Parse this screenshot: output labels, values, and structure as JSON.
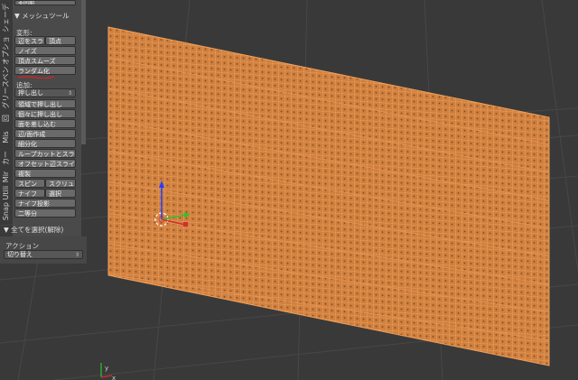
{
  "toolshelf": {
    "top_partial_label": "非同期",
    "tabs": [
      "シェーデ",
      "オプショ",
      "グリースペン",
      "回",
      "Mis",
      "カー",
      "Mir",
      "Snap Utili"
    ],
    "mesh_tools_header": "▼ メッシュツール",
    "deform_label": "変形:",
    "deform_buttons": {
      "slide_edge": "辺をスラ",
      "vertex": "頂点",
      "noise": "ノイズ",
      "smooth_vertex": "頂点スムーズ",
      "randomize": "ランダム化"
    },
    "add_label": "追加:",
    "extrude_select": "押し出し",
    "add_buttons": {
      "extrude_region": "領域で押し出し",
      "extrude_individual": "個々に押し出し",
      "inset": "面を差し込む",
      "edge_face": "辺/面作成",
      "subdivide": "細分化",
      "loopcut": "ループカットとスラ…",
      "offset_edge": "オフセット辺スライ…",
      "duplicate": "複製",
      "spin": "スピン",
      "screw": "スクリュ",
      "knife": "ナイフ",
      "select": "選択",
      "knife_project": "ナイフ投影",
      "bisect": "二等分"
    },
    "deselect_all_header": "▼ 全てを選択(解除)",
    "action_label": "アクション",
    "action_select": "切り替え"
  },
  "axis_gizmo": {
    "x": "x",
    "y": "y"
  },
  "colors": {
    "mesh_face": "#d88a45",
    "mesh_wire": "#f0a060",
    "background": "#393939",
    "grid": "#474747"
  }
}
